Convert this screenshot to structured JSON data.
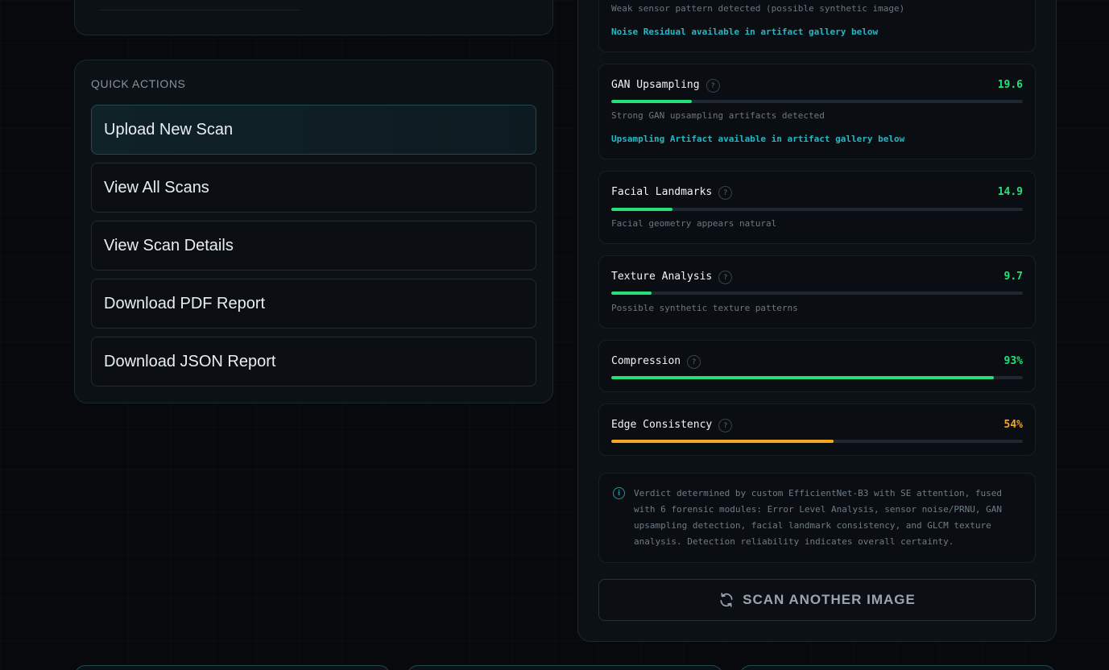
{
  "quick_actions": {
    "title": "QUICK ACTIONS",
    "buttons": [
      {
        "label": "Upload New Scan"
      },
      {
        "label": "View All Scans"
      },
      {
        "label": "View Scan Details"
      },
      {
        "label": "Download PDF Report"
      },
      {
        "label": "Download JSON Report"
      }
    ]
  },
  "noise_residual": {
    "description": "Weak sensor pattern detected (possible synthetic image)",
    "artifact_note": "Noise Residual available in artifact gallery below"
  },
  "modules": [
    {
      "name": "GAN Upsampling",
      "value": "19.6",
      "level": 0.196,
      "description": "Strong GAN upsampling artifacts detected",
      "artifact_note": "Upsampling Artifact available in artifact gallery below",
      "status_color": "#22e07a"
    },
    {
      "name": "Facial Landmarks",
      "value": "14.9",
      "level": 0.149,
      "description": "Facial geometry appears natural",
      "status_color": "#22e07a"
    },
    {
      "name": "Texture Analysis",
      "value": "9.7",
      "level": 0.097,
      "description": "Possible synthetic texture patterns",
      "status_color": "#22e07a"
    },
    {
      "name": "Compression",
      "value": "93%",
      "level": 0.93,
      "status_color": "#22e07a"
    },
    {
      "name": "Edge Consistency",
      "value": "54%",
      "level": 0.54,
      "status_color": "#f5a623"
    }
  ],
  "help_icon_glyph": "?",
  "verdict_note": "Verdict determined by custom EfficientNet-B3 with SE attention, fused with 6 forensic modules: Error Level Analysis, sensor noise/PRNU, GAN upsampling detection, facial landmark consistency, and GLCM texture analysis. Detection reliability indicates overall certainty.",
  "scan_another_label": "SCAN ANOTHER IMAGE",
  "icons": {
    "info": "info-icon",
    "refresh": "refresh-icon",
    "help": "help-icon"
  }
}
